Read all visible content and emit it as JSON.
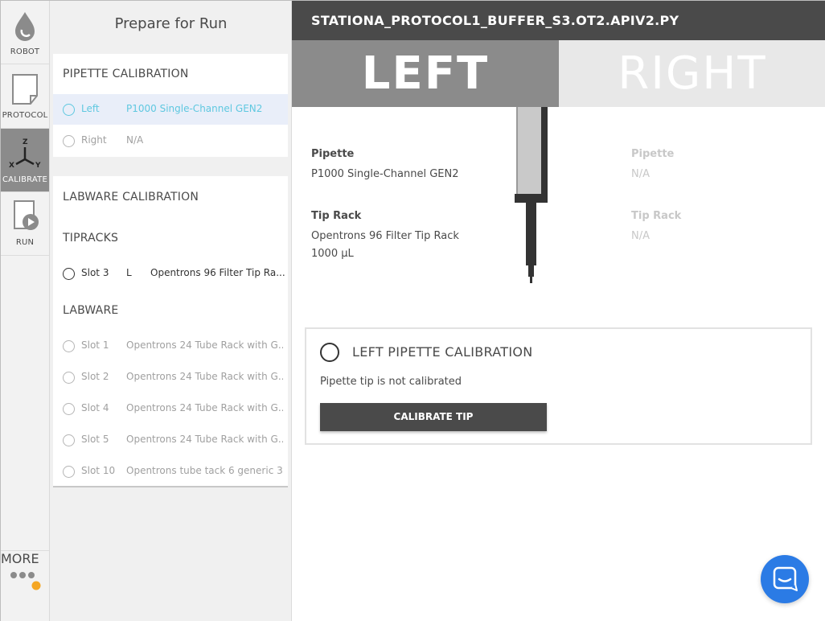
{
  "nav": {
    "items": [
      {
        "label": "ROBOT",
        "icon": "robot-droplet-icon"
      },
      {
        "label": "PROTOCOL",
        "icon": "document-icon"
      },
      {
        "label": "CALIBRATE",
        "icon": "xyz-axes-icon"
      },
      {
        "label": "RUN",
        "icon": "play-document-icon"
      }
    ],
    "more_label": "MORE",
    "notification_color": "#f5a623"
  },
  "panel": {
    "title": "Prepare for Run",
    "pipette_section": "PIPETTE CALIBRATION",
    "pipettes": [
      {
        "mount": "Left",
        "name": "P1000 Single-Channel GEN2"
      },
      {
        "mount": "Right",
        "name": "N/A"
      }
    ],
    "labware_section": "LABWARE CALIBRATION",
    "tipracks_heading": "TIPRACKS",
    "tipracks": [
      {
        "slot": "Slot 3",
        "mount": "L",
        "name": "Opentrons 96 Filter Tip Ra..."
      }
    ],
    "labware_heading": "LABWARE",
    "labware": [
      {
        "slot": "Slot 1",
        "name": "Opentrons 24 Tube Rack with G..."
      },
      {
        "slot": "Slot 2",
        "name": "Opentrons 24 Tube Rack with G..."
      },
      {
        "slot": "Slot 4",
        "name": "Opentrons 24 Tube Rack with G..."
      },
      {
        "slot": "Slot 5",
        "name": "Opentrons 24 Tube Rack with G..."
      },
      {
        "slot": "Slot 10",
        "name": "Opentrons tube tack 6 generic 3..."
      }
    ]
  },
  "main": {
    "file_title": "STATIONA_PROTOCOL1_BUFFER_S3.OT2.APIV2.PY",
    "tabs": {
      "left": "LEFT",
      "right": "RIGHT"
    },
    "left_info": {
      "pipette_label": "Pipette",
      "pipette_value": "P1000 Single-Channel GEN2",
      "tiprack_label": "Tip Rack",
      "tiprack_value_line1": "Opentrons 96 Filter Tip Rack",
      "tiprack_value_line2": "1000 µL"
    },
    "right_info": {
      "pipette_label": "Pipette",
      "pipette_value": "N/A",
      "tiprack_label": "Tip Rack",
      "tiprack_value": "N/A"
    },
    "calibration": {
      "title": "LEFT PIPETTE CALIBRATION",
      "message": "Pipette tip is not calibrated",
      "button": "CALIBRATE TIP"
    }
  },
  "colors": {
    "accent": "#5fc8e0",
    "titlebar": "#4a4a4a",
    "chat": "#2b7be5"
  }
}
